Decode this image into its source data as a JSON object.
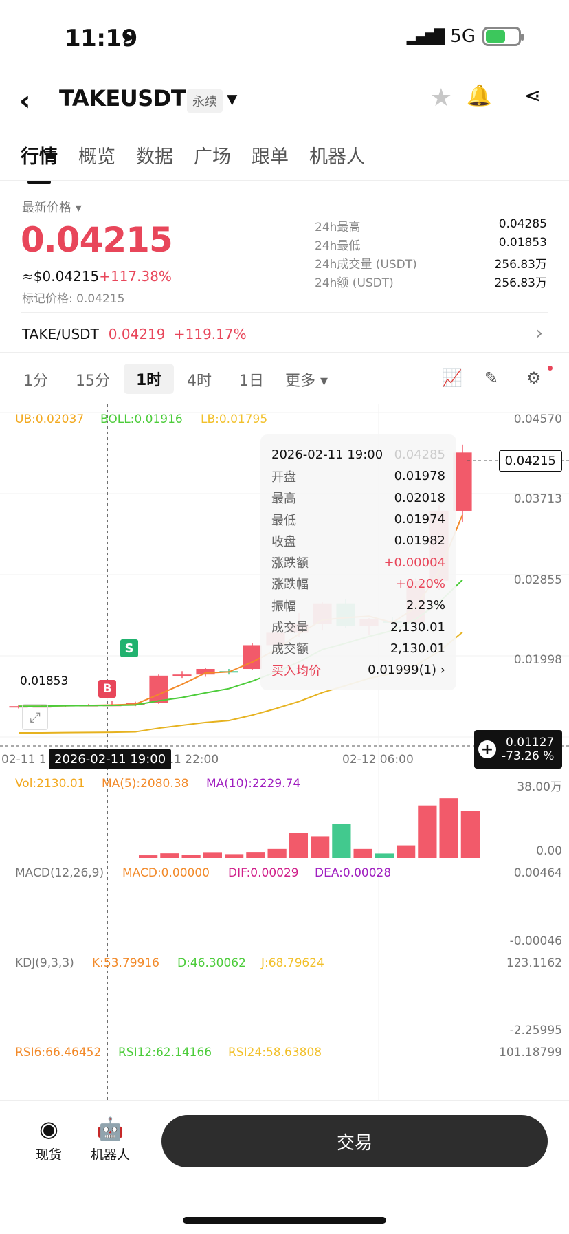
{
  "status": {
    "time": "11:19",
    "network": "5G"
  },
  "header": {
    "symbol": "TAKEUSDT",
    "contract_tag": "永续"
  },
  "tabs": [
    {
      "label": "行情",
      "active": true
    },
    {
      "label": "概览"
    },
    {
      "label": "数据"
    },
    {
      "label": "广场"
    },
    {
      "label": "跟单"
    },
    {
      "label": "机器人"
    }
  ],
  "price": {
    "label": "最新价格",
    "last": "0.04215",
    "usd": "≈$0.04215",
    "change": "+117.38%",
    "mark": "标记价格: 0.04215"
  },
  "stats": [
    {
      "k": "24h最高",
      "v": "0.04285"
    },
    {
      "k": "24h最低",
      "v": "0.01853"
    },
    {
      "k": "24h成交量 (USDT)",
      "v": "256.83万"
    },
    {
      "k": "24h额 (USDT)",
      "v": "256.83万"
    }
  ],
  "spot": {
    "pair": "TAKE/USDT",
    "price": "0.04219",
    "change": "+119.17%"
  },
  "intervals": {
    "i1": "1分",
    "i2": "15分",
    "i3": "1时",
    "i4": "4时",
    "i5": "1日",
    "more": "更多"
  },
  "boll": {
    "ub": "UB:0.02037",
    "boll": "BOLL:0.01916",
    "lb": "LB:0.01795"
  },
  "yaxis": {
    "p1": "0.04570",
    "p2": "0.03713",
    "p3": "0.02855",
    "p4": "0.01998"
  },
  "tooltip": {
    "date": "2026-02-11 19:00",
    "ghost": "0.04285",
    "rows": [
      {
        "k": "开盘",
        "v": "0.01978"
      },
      {
        "k": "最高",
        "v": "0.02018"
      },
      {
        "k": "最低",
        "v": "0.01974"
      },
      {
        "k": "收盘",
        "v": "0.01982"
      },
      {
        "k": "涨跌额",
        "v": "+0.00004"
      },
      {
        "k": "涨跌幅",
        "v": "+0.20%"
      },
      {
        "k": "振幅",
        "v": "2.23%"
      },
      {
        "k": "成交量",
        "v": "2,130.01"
      },
      {
        "k": "成交额",
        "v": "2,130.01"
      }
    ],
    "avg_label": "买入均价",
    "avg_value": "0.01999(1)"
  },
  "price_tag": "0.04215",
  "low_marker": "0.01853",
  "cursor": {
    "value": "0.01127",
    "pct": "-73.26 %",
    "time": "2026-02-11 19:00"
  },
  "xaxis": {
    "a": "02-11 1",
    "b": "-11 22:00",
    "c": "02-12 06:00"
  },
  "markers": {
    "s": "S",
    "b": "B"
  },
  "volume": {
    "vol": "Vol:2130.01",
    "ma5": "MA(5):2080.38",
    "ma10": "MA(10):2229.74",
    "max": "38.00万",
    "min": "0.00"
  },
  "macd": {
    "title": "MACD(12,26,9)",
    "macd": "MACD:0.00000",
    "dif": "DIF:0.00029",
    "dea": "DEA:0.00028",
    "max": "0.00464",
    "min": "-0.00046"
  },
  "kdj": {
    "title": "KDJ(9,3,3)",
    "k": "K:53.79916",
    "d": "D:46.30062",
    "j": "J:68.79624",
    "max": "123.1162",
    "min": "-2.25995"
  },
  "rsi": {
    "r6": "RSI6:66.46452",
    "r12": "RSI12:62.14166",
    "r24": "RSI24:58.63808",
    "max": "101.18799"
  },
  "bottom": {
    "spot": "现货",
    "bot": "机器人",
    "trade": "交易"
  },
  "chart_data": {
    "type": "candlestick",
    "candles": [
      {
        "o": 0.0196,
        "h": 0.0198,
        "l": 0.0195,
        "c": 0.0197
      },
      {
        "o": 0.0197,
        "h": 0.0198,
        "l": 0.0196,
        "c": 0.0197
      },
      {
        "o": 0.0197,
        "h": 0.0198,
        "l": 0.0196,
        "c": 0.0198
      },
      {
        "o": 0.0198,
        "h": 0.0199,
        "l": 0.0197,
        "c": 0.0198
      },
      {
        "o": 0.01978,
        "h": 0.02018,
        "l": 0.01974,
        "c": 0.01982
      },
      {
        "o": 0.0198,
        "h": 0.0201,
        "l": 0.0197,
        "c": 0.02
      },
      {
        "o": 0.02,
        "h": 0.0225,
        "l": 0.0199,
        "c": 0.0224
      },
      {
        "o": 0.0224,
        "h": 0.0228,
        "l": 0.0222,
        "c": 0.0225
      },
      {
        "o": 0.0225,
        "h": 0.0231,
        "l": 0.0223,
        "c": 0.023
      },
      {
        "o": 0.0228,
        "h": 0.023,
        "l": 0.0225,
        "c": 0.0227
      },
      {
        "o": 0.023,
        "h": 0.0253,
        "l": 0.0229,
        "c": 0.0251
      },
      {
        "o": 0.0251,
        "h": 0.0265,
        "l": 0.0249,
        "c": 0.0262
      },
      {
        "o": 0.0262,
        "h": 0.028,
        "l": 0.0258,
        "c": 0.027
      },
      {
        "o": 0.027,
        "h": 0.0289,
        "l": 0.0264,
        "c": 0.0288
      },
      {
        "o": 0.0288,
        "h": 0.0292,
        "l": 0.0266,
        "c": 0.0268
      },
      {
        "o": 0.0268,
        "h": 0.0275,
        "l": 0.026,
        "c": 0.0274
      },
      {
        "o": 0.0272,
        "h": 0.0276,
        "l": 0.0266,
        "c": 0.0271
      },
      {
        "o": 0.0271,
        "h": 0.031,
        "l": 0.0268,
        "c": 0.0308
      },
      {
        "o": 0.0308,
        "h": 0.0375,
        "l": 0.03,
        "c": 0.037
      },
      {
        "o": 0.037,
        "h": 0.04285,
        "l": 0.036,
        "c": 0.04215
      }
    ],
    "volume_bars": [
      1500,
      2600,
      1800,
      2900,
      2130,
      3000,
      5000,
      14000,
      12000,
      19000,
      5000,
      2500,
      7000,
      29000,
      33000,
      26000
    ]
  }
}
